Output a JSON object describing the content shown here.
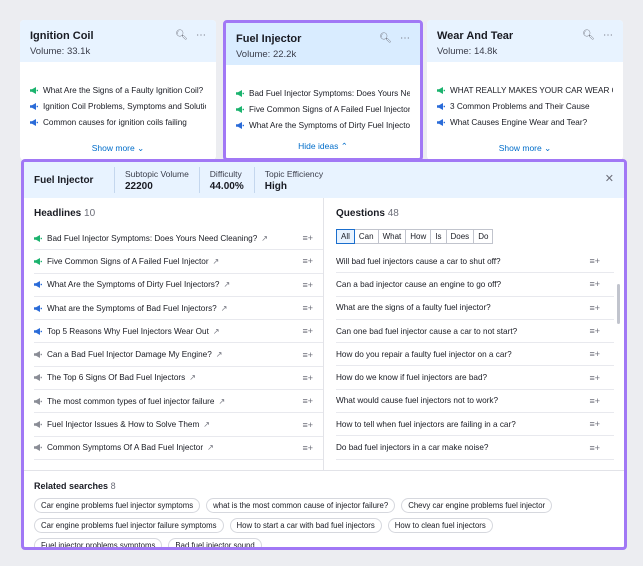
{
  "cards": [
    {
      "title": "Ignition Coil",
      "volume": "Volume: 33.1k",
      "items": [
        {
          "text": "What Are the Signs of a Faulty Ignition Coil?",
          "icon": "megaphone-green"
        },
        {
          "text": "Ignition Coil Problems, Symptoms and Solutions",
          "icon": "megaphone-blue"
        },
        {
          "text": "Common causes for ignition coils failing",
          "icon": "megaphone-blue"
        }
      ],
      "more": "Show more"
    },
    {
      "title": "Fuel Injector",
      "volume": "Volume: 22.2k",
      "items": [
        {
          "text": "Bad Fuel Injector Symptoms: Does Yours Need Cl...",
          "icon": "megaphone-green"
        },
        {
          "text": "Five Common Signs of A Failed Fuel Injector",
          "icon": "megaphone-green"
        },
        {
          "text": "What Are the Symptoms of Dirty Fuel Injectors?",
          "icon": "megaphone-blue"
        }
      ],
      "more": "Hide ideas"
    },
    {
      "title": "Wear And Tear",
      "volume": "Volume: 14.8k",
      "items": [
        {
          "text": "WHAT REALLY MAKES YOUR CAR WEAR OUT?",
          "icon": "megaphone-green"
        },
        {
          "text": "3 Common Problems and Their Cause",
          "icon": "megaphone-blue"
        },
        {
          "text": "What Causes Engine Wear and Tear?",
          "icon": "megaphone-blue"
        }
      ],
      "more": "Show more"
    }
  ],
  "panel": {
    "title": "Fuel Injector",
    "metrics": [
      {
        "label": "Subtopic Volume",
        "value": "22200"
      },
      {
        "label": "Difficulty",
        "value": "44.00%"
      },
      {
        "label": "Topic Efficiency",
        "value": "High"
      }
    ],
    "headlines_title": "Headlines",
    "headlines_count": "10",
    "headlines": [
      {
        "text": "Bad Fuel Injector Symptoms: Does Yours Need Cleaning?",
        "icon": "megaphone-green"
      },
      {
        "text": "Five Common Signs of A Failed Fuel Injector",
        "icon": "megaphone-green"
      },
      {
        "text": "What Are the Symptoms of Dirty Fuel Injectors?",
        "icon": "megaphone-blue"
      },
      {
        "text": "What are the Symptoms of Bad Fuel Injectors?",
        "icon": "megaphone-blue"
      },
      {
        "text": "Top 5 Reasons Why Fuel Injectors Wear Out",
        "icon": "megaphone-blue"
      },
      {
        "text": "Can a Bad Fuel Injector Damage My Engine?",
        "icon": "megaphone-grey"
      },
      {
        "text": "The Top 6 Signs Of Bad Fuel Injectors",
        "icon": "megaphone-grey"
      },
      {
        "text": "The most common types of fuel injector failure",
        "icon": "megaphone-grey"
      },
      {
        "text": "Fuel Injector Issues & How to Solve Them",
        "icon": "megaphone-grey"
      },
      {
        "text": "Common Symptoms Of A Bad Fuel Injector",
        "icon": "megaphone-grey"
      }
    ],
    "questions_title": "Questions",
    "questions_count": "48",
    "filters": [
      "All",
      "Can",
      "What",
      "How",
      "Is",
      "Does",
      "Do"
    ],
    "questions": [
      "Will bad fuel injectors cause a car to shut off?",
      "Can a bad injector cause an engine to go off?",
      "What are the signs of a faulty fuel injector?",
      "Can one bad fuel injector cause a car to not start?",
      "How do you repair a faulty fuel injector on a car?",
      "How do we know if fuel injectors are bad?",
      "What would cause fuel injectors not to work?",
      "How to tell when fuel injectors are failing in a car?",
      "Do bad fuel injectors in a car make noise?"
    ],
    "related_title": "Related searches",
    "related_count": "8",
    "related": [
      "Car engine problems fuel injector symptoms",
      "what is the most common cause of injector failure?",
      "Chevy car engine problems fuel injector",
      "Car engine problems fuel injector failure symptoms",
      "How to start a car with bad fuel injectors",
      "How to clean fuel injectors",
      "Fuel injector problems symptoms",
      "Bad fuel injector sound"
    ]
  },
  "colors": {
    "accent_border": "#a178f5",
    "megaphone_green": "#1bb36e",
    "megaphone_blue": "#2a6bd8",
    "megaphone_grey": "#8a8d96",
    "link": "#006dca"
  }
}
